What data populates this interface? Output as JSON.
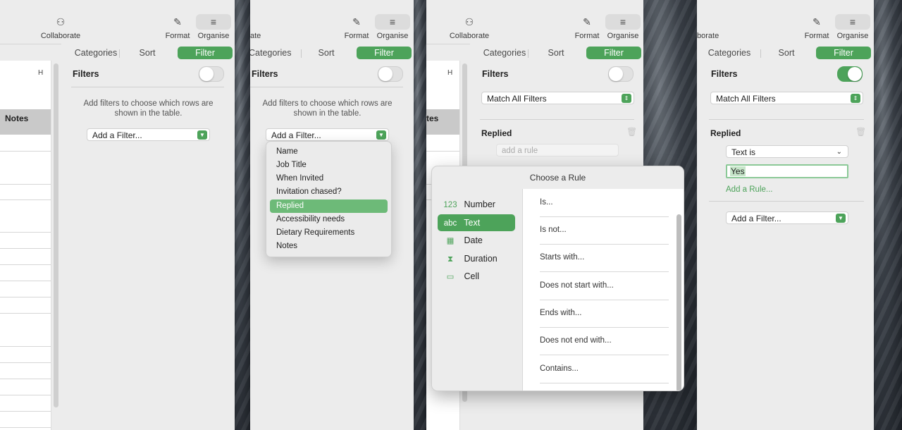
{
  "toolbar": {
    "collaborate": "Collaborate",
    "collaborate_clip_2": "ate",
    "collaborate_clip_4": "borate",
    "format": "Format",
    "organise": "Organise"
  },
  "tabs": {
    "categories": "Categories",
    "sort": "Sort",
    "filter": "Filter"
  },
  "sheet": {
    "col_h": "H",
    "notes_header": "Notes",
    "col_header_clip": "tes"
  },
  "filters": {
    "title": "Filters",
    "empty_msg_line1": "Add filters to choose which rows are",
    "empty_msg_line2": "shown in the table.",
    "add_filter": "Add a Filter...",
    "match_all": "Match All Filters"
  },
  "dropdown": {
    "items": [
      "Name",
      "Job Title",
      "When Invited",
      "Invitation chased?",
      "Replied",
      "Accessibility needs",
      "Dietary Requirements",
      "Notes"
    ],
    "highlighted_index": 4
  },
  "panel3": {
    "section": "Replied",
    "rule_placeholder": "add a rule"
  },
  "popover": {
    "title": "Choose a Rule",
    "categories": [
      {
        "icon": "123",
        "label": "Number"
      },
      {
        "icon": "abc",
        "label": "Text"
      },
      {
        "icon": "calendar-icon",
        "label": "Date"
      },
      {
        "icon": "hourglass-icon",
        "label": "Duration"
      },
      {
        "icon": "cell-icon",
        "label": "Cell"
      }
    ],
    "selected_category": 1,
    "rules": [
      "Is...",
      "Is not...",
      "Starts with...",
      "Does not start with...",
      "Ends with...",
      "Does not end with...",
      "Contains..."
    ]
  },
  "panel4": {
    "section": "Replied",
    "rule_type": "Text is",
    "rule_value": "Yes",
    "add_rule": "Add a Rule..."
  },
  "colors": {
    "accent": "#4da35a",
    "menu_highlight": "#6dba78"
  }
}
